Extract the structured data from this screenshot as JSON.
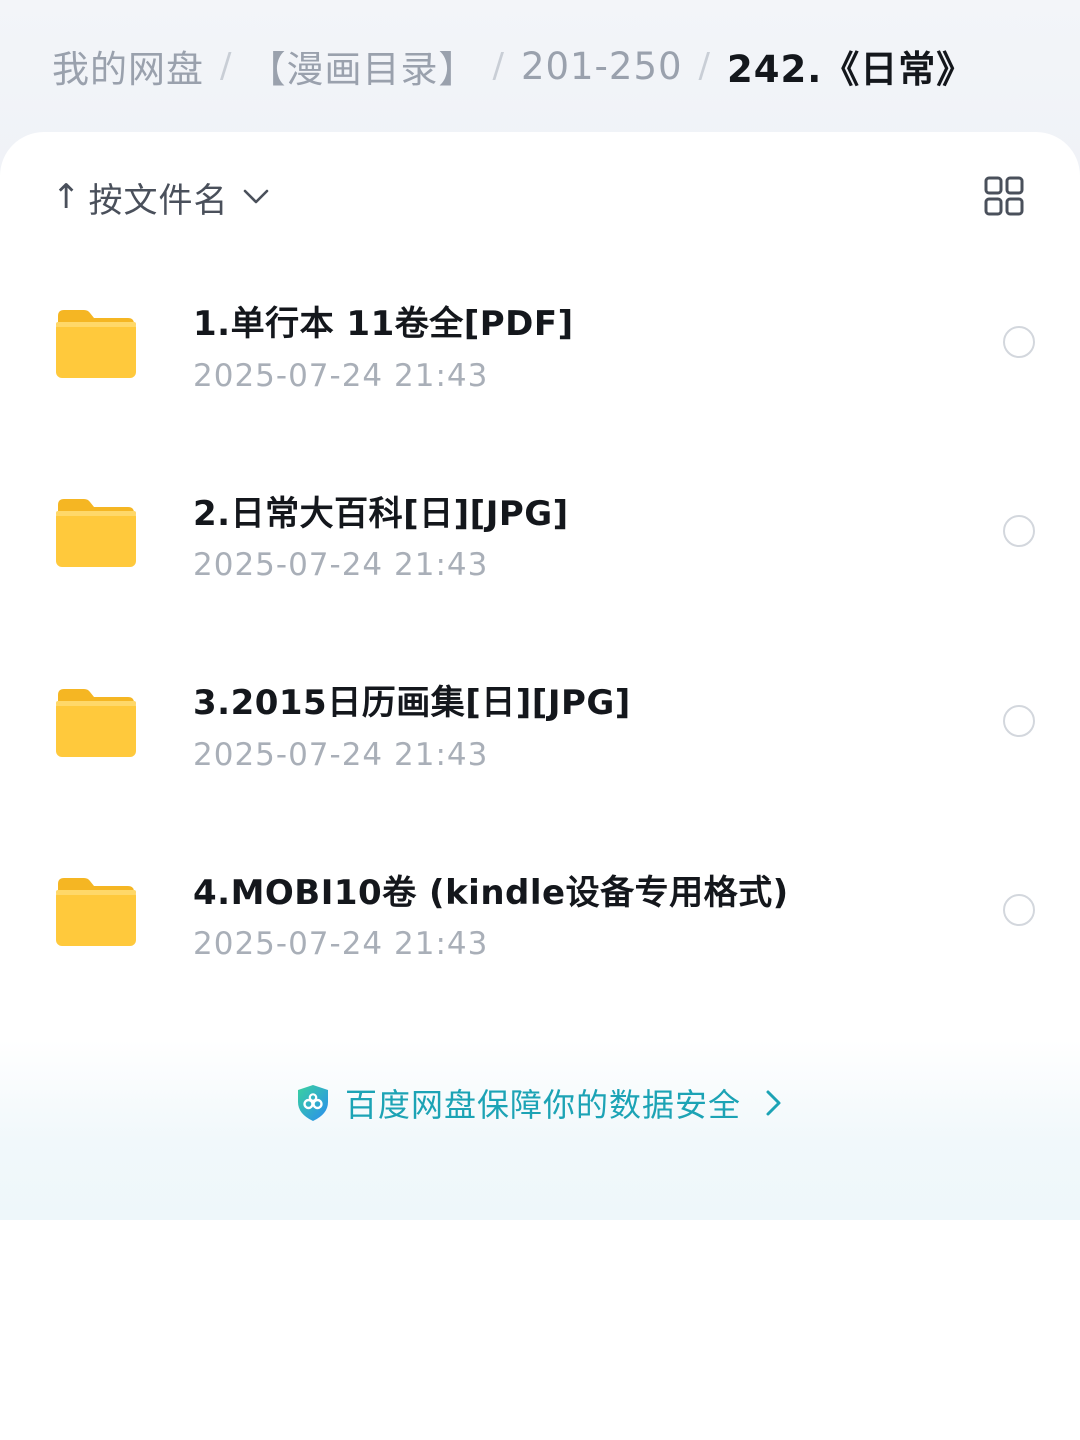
{
  "breadcrumb": {
    "items": [
      "我的网盘",
      "【漫画目录】",
      "201-250",
      "242.《日常》"
    ],
    "separator": "/"
  },
  "toolbar": {
    "sort_arrow": "↑",
    "sort_label": "按文件名",
    "sort_dropdown_icon": "chevron-down-icon",
    "view_toggle_icon": "grid-view-icon"
  },
  "files": [
    {
      "name": "1.单行本 11卷全[PDF]",
      "date": "2025-07-24 21:43",
      "icon": "folder-icon"
    },
    {
      "name": "2.日常大百科[日][JPG]",
      "date": "2025-07-24 21:43",
      "icon": "folder-icon"
    },
    {
      "name": "3.2015日历画集[日][JPG]",
      "date": "2025-07-24 21:43",
      "icon": "folder-icon"
    },
    {
      "name": "4.MOBI10卷 (kindle设备专用格式)",
      "date": "2025-07-24 21:43",
      "icon": "folder-icon"
    }
  ],
  "footer": {
    "security_text": "百度网盘保障你的数据安全",
    "icon": "shield-icon",
    "link_icon": "chevron-right-icon"
  },
  "colors": {
    "accent": "#1ca3b5",
    "folder": "#ffc93c",
    "text_primary": "#14171c",
    "text_secondary": "#a9afb8"
  }
}
